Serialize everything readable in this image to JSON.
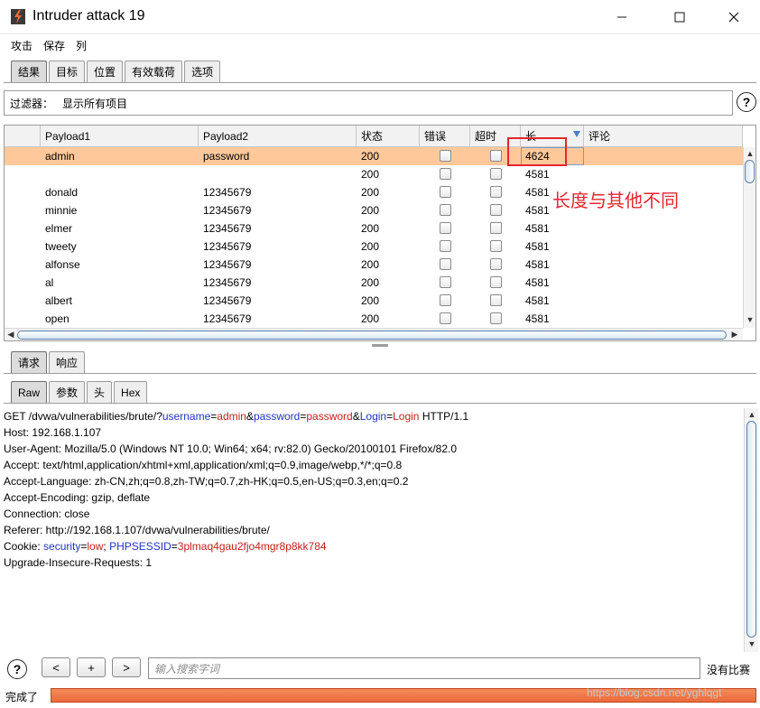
{
  "window": {
    "title": "Intruder attack 19",
    "min": "—",
    "max": "☐",
    "close": "✕"
  },
  "menu": [
    "攻击",
    "保存",
    "列"
  ],
  "top_tabs": [
    "结果",
    "目标",
    "位置",
    "有效载荷",
    "选项"
  ],
  "filter": {
    "label": "过滤器：",
    "value": "显示所有项目"
  },
  "table": {
    "columns": [
      "",
      "Payload1",
      "Payload2",
      "状态",
      "错误",
      "超时",
      "长",
      "评论"
    ],
    "rows": [
      {
        "id": "",
        "p1": "admin",
        "p2": "password",
        "status": "200",
        "length": "4624",
        "selected": true
      },
      {
        "id": "",
        "p1": "",
        "p2": "",
        "status": "200",
        "length": "4581"
      },
      {
        "id": "",
        "p1": "donald",
        "p2": "12345679",
        "status": "200",
        "length": "4581"
      },
      {
        "id": "",
        "p1": "minnie",
        "p2": "12345679",
        "status": "200",
        "length": "4581"
      },
      {
        "id": "",
        "p1": "elmer",
        "p2": "12345679",
        "status": "200",
        "length": "4581"
      },
      {
        "id": "",
        "p1": "tweety",
        "p2": "12345679",
        "status": "200",
        "length": "4581"
      },
      {
        "id": "",
        "p1": "alfonse",
        "p2": "12345679",
        "status": "200",
        "length": "4581"
      },
      {
        "id": "",
        "p1": "al",
        "p2": "12345679",
        "status": "200",
        "length": "4581"
      },
      {
        "id": "",
        "p1": "albert",
        "p2": "12345679",
        "status": "200",
        "length": "4581"
      },
      {
        "id": "",
        "p1": "open",
        "p2": "12345679",
        "status": "200",
        "length": "4581"
      }
    ]
  },
  "annotation": "长度与其他不同",
  "req_tabs": [
    "请求",
    "响应"
  ],
  "view_tabs": [
    "Raw",
    "参数",
    "头",
    "Hex"
  ],
  "request": {
    "l1": {
      "a": "GET /dvwa/vulnerabilities/brute/?",
      "k1": "username",
      "eq1": "=",
      "v1": "admin",
      "amp1": "&",
      "k2": "password",
      "eq2": "=",
      "v2": "password",
      "amp2": "&",
      "k3": "Login",
      "eq3": "=",
      "v3": "Login",
      "b": " HTTP/1.1"
    },
    "lines": [
      "Host: 192.168.1.107",
      "User-Agent: Mozilla/5.0 (Windows NT 10.0; Win64; x64; rv:82.0) Gecko/20100101 Firefox/82.0",
      "Accept: text/html,application/xhtml+xml,application/xml;q=0.9,image/webp,*/*;q=0.8",
      "Accept-Language: zh-CN,zh;q=0.8,zh-TW;q=0.7,zh-HK;q=0.5,en-US;q=0.3,en;q=0.2",
      "Accept-Encoding: gzip, deflate",
      "Connection: close",
      "Referer: http://192.168.1.107/dvwa/vulnerabilities/brute/"
    ],
    "cookie": {
      "a": "Cookie: ",
      "k1": "security",
      "eq1": "=",
      "v1": "low",
      "sep": "; ",
      "k2": "PHPSESSID",
      "eq2": "=",
      "v2": "3plmaq4gau2fjo4mgr8p8kk784"
    },
    "last": "Upgrade-Insecure-Requests: 1"
  },
  "search": {
    "help": "?",
    "prev": "<",
    "add": "+",
    "next": ">",
    "placeholder": "输入搜索字词",
    "matches": "没有比赛"
  },
  "status": {
    "text": "完成了",
    "progress": 1.0
  },
  "watermark": "https://blog.csdn.net/yghlqgt",
  "colors": {
    "selected_row": "#ffc89a",
    "annotation": "#e5262c",
    "progress": "#ec6a3a",
    "param_key": "#1f35c4",
    "param_value": "#c5201c"
  },
  "icons": {
    "app": "burp-logo-icon",
    "help": "help-circle-icon"
  }
}
